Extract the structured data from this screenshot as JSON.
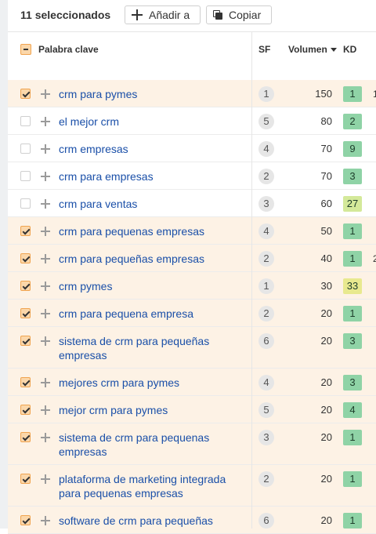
{
  "toolbar": {
    "selected_label": "11 seleccionados",
    "add_label": "Añadir a",
    "copy_label": "Copiar"
  },
  "table": {
    "headers": {
      "keyword": "Palabra clave",
      "sf": "SF",
      "volume": "Volumen",
      "kd": "KD"
    },
    "rows": [
      {
        "keyword": "crm para pymes",
        "sf": "1",
        "volume": "150",
        "kd": "1",
        "checked": true,
        "kd_color": "#8fd3a6",
        "stray": "1"
      },
      {
        "keyword": "el mejor crm",
        "sf": "5",
        "volume": "80",
        "kd": "2",
        "checked": false,
        "kd_color": "#8fd3a6"
      },
      {
        "keyword": "crm empresas",
        "sf": "4",
        "volume": "70",
        "kd": "9",
        "checked": false,
        "kd_color": "#8fd3a6"
      },
      {
        "keyword": "crm para empresas",
        "sf": "2",
        "volume": "70",
        "kd": "3",
        "checked": false,
        "kd_color": "#8fd3a6"
      },
      {
        "keyword": "crm para ventas",
        "sf": "3",
        "volume": "60",
        "kd": "27",
        "checked": false,
        "kd_color": "#d4e99a"
      },
      {
        "keyword": "crm para pequenas empresas",
        "sf": "4",
        "volume": "50",
        "kd": "1",
        "checked": true,
        "kd_color": "#8fd3a6"
      },
      {
        "keyword": "crm para pequeñas empresas",
        "sf": "2",
        "volume": "40",
        "kd": "1",
        "checked": true,
        "kd_color": "#8fd3a6",
        "stray": "2"
      },
      {
        "keyword": "crm pymes",
        "sf": "1",
        "volume": "30",
        "kd": "33",
        "checked": true,
        "kd_color": "#e8e98f"
      },
      {
        "keyword": "crm para pequena empresa",
        "sf": "2",
        "volume": "20",
        "kd": "1",
        "checked": true,
        "kd_color": "#8fd3a6"
      },
      {
        "keyword": "sistema de crm para pequeñas empresas",
        "sf": "6",
        "volume": "20",
        "kd": "3",
        "checked": true,
        "kd_color": "#8fd3a6"
      },
      {
        "keyword": "mejores crm para pymes",
        "sf": "4",
        "volume": "20",
        "kd": "3",
        "checked": true,
        "kd_color": "#8fd3a6"
      },
      {
        "keyword": "mejor crm para pymes",
        "sf": "5",
        "volume": "20",
        "kd": "4",
        "checked": true,
        "kd_color": "#8fd3a6"
      },
      {
        "keyword": "sistema de crm para pequenas empresas",
        "sf": "3",
        "volume": "20",
        "kd": "1",
        "checked": true,
        "kd_color": "#8fd3a6"
      },
      {
        "keyword": "plataforma de marketing integrada para pequenas empresas",
        "sf": "2",
        "volume": "20",
        "kd": "1",
        "checked": true,
        "kd_color": "#8fd3a6"
      },
      {
        "keyword": "software de crm para pequeñas",
        "sf": "6",
        "volume": "20",
        "kd": "1",
        "checked": true,
        "kd_color": "#8fd3a6"
      }
    ]
  }
}
